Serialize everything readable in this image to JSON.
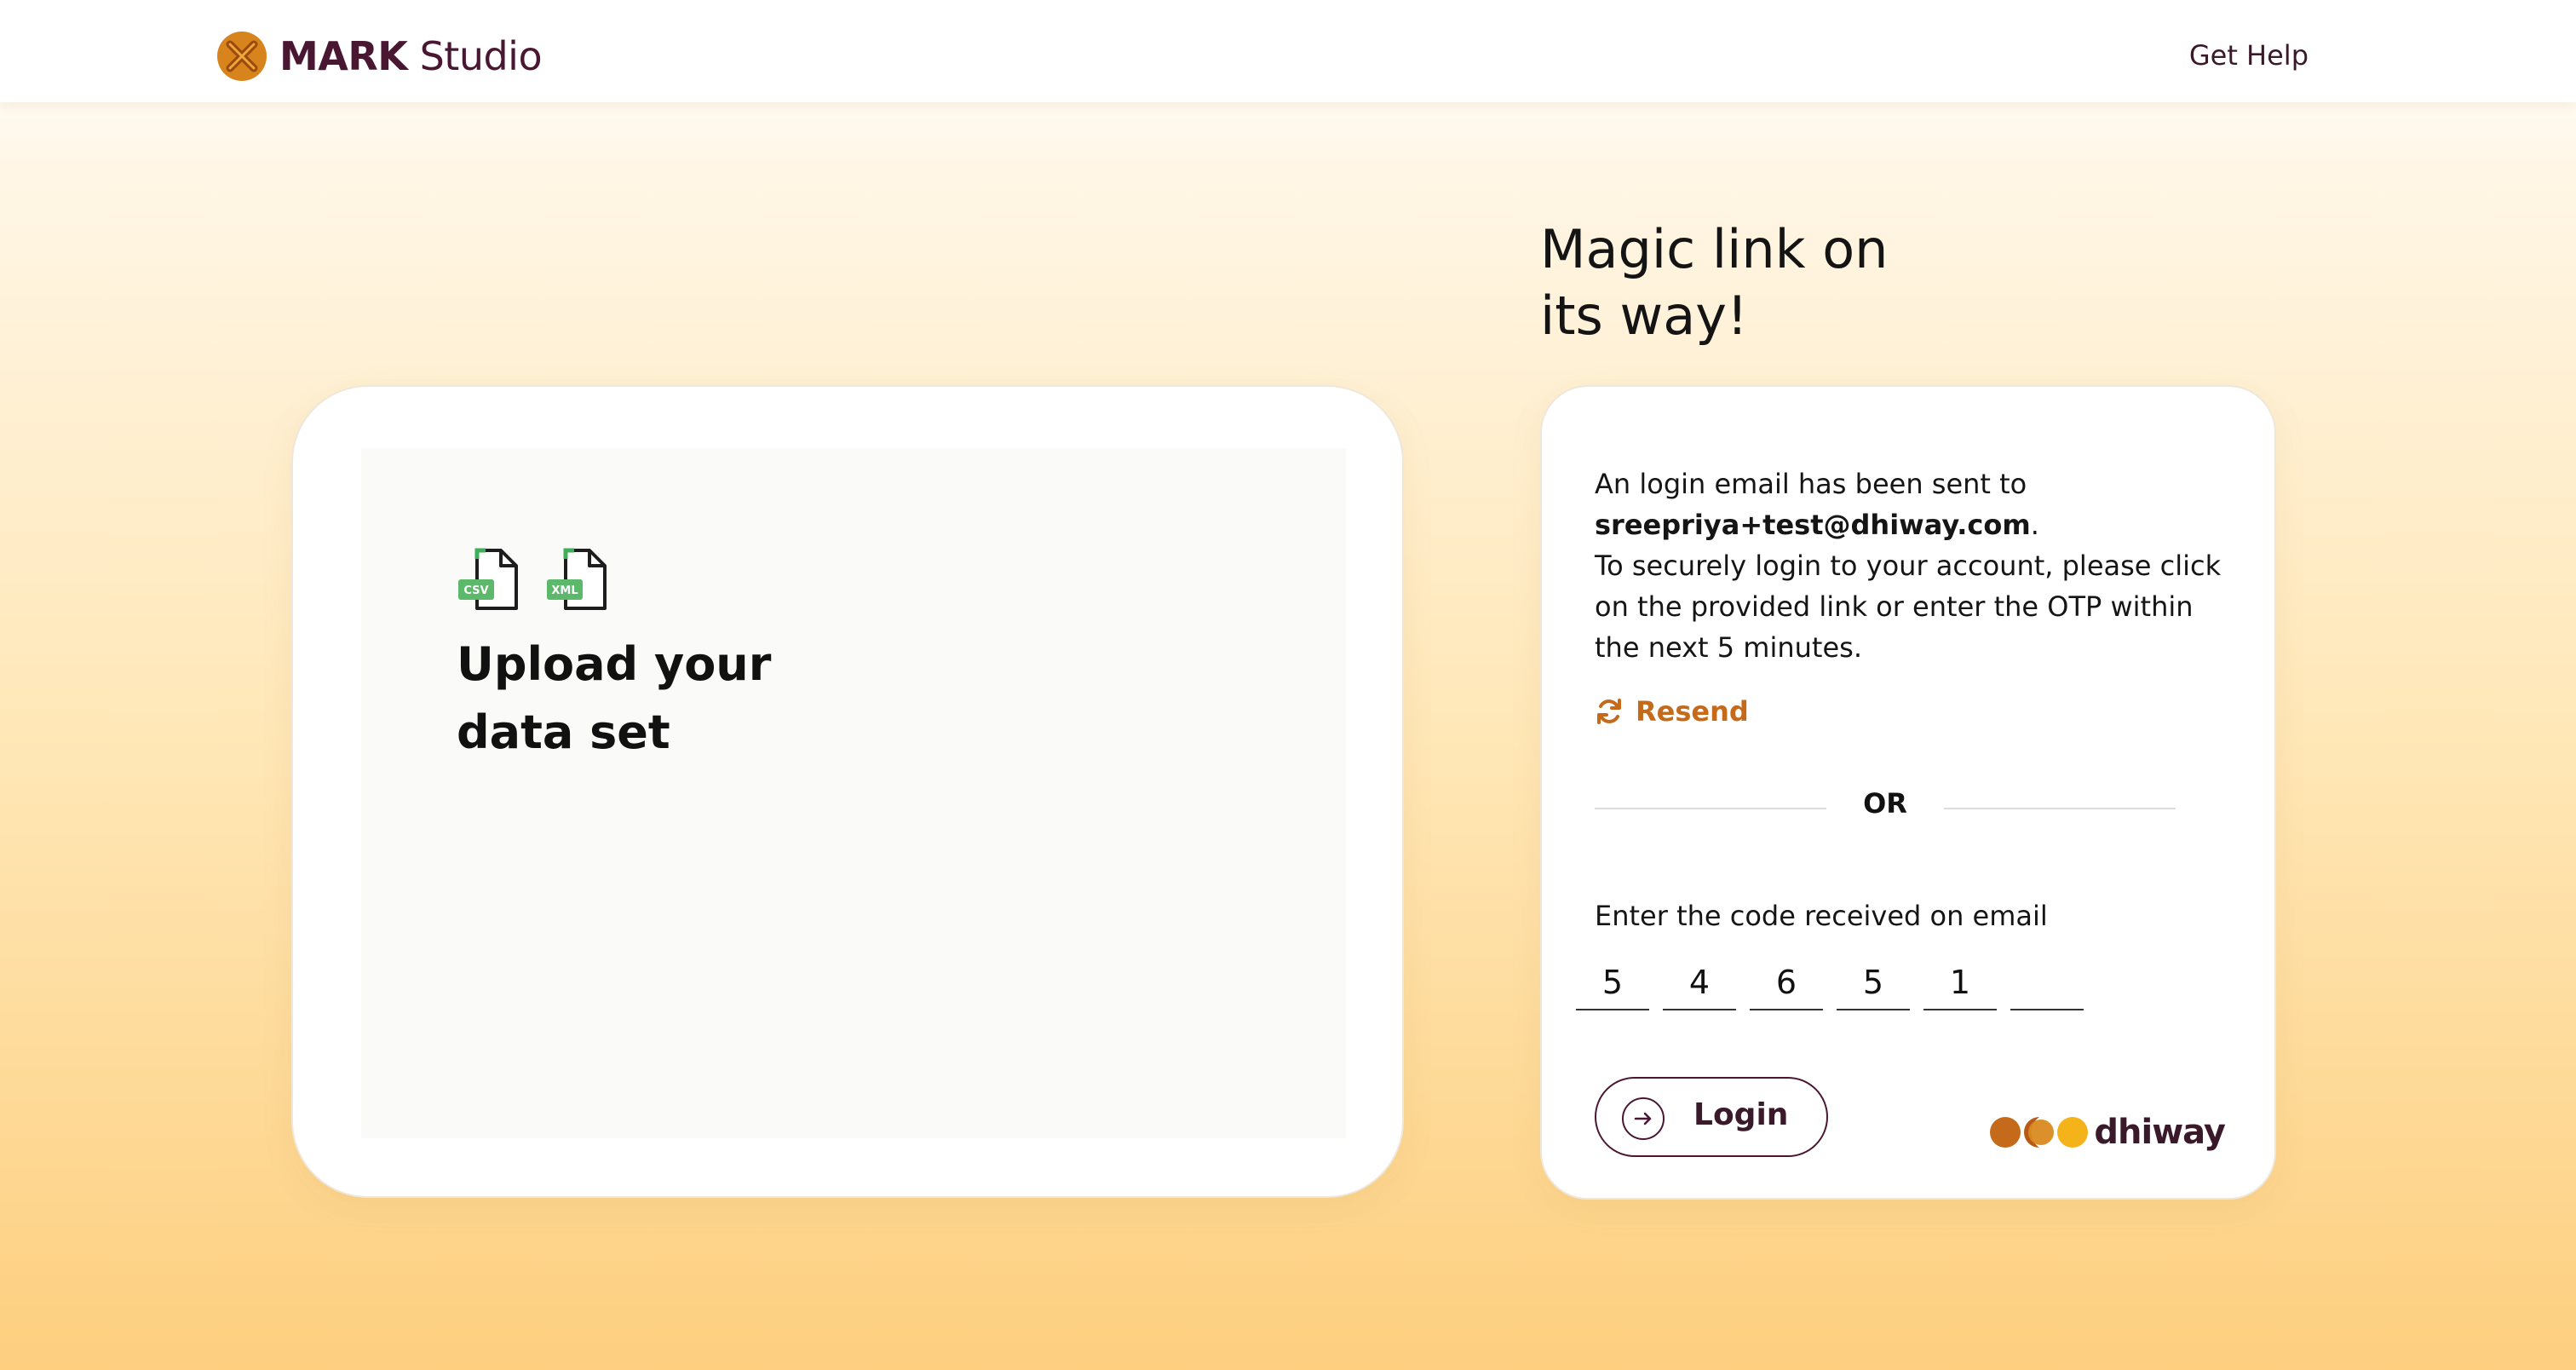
{
  "header": {
    "brand_bold": "MARK",
    "brand_light": "Studio",
    "help_label": "Get Help"
  },
  "left_card": {
    "file_icons": [
      {
        "name": "csv-file-icon",
        "tag": "CSV"
      },
      {
        "name": "xml-file-icon",
        "tag": "XML"
      }
    ],
    "title_line1": "Upload your",
    "title_line2": "data set"
  },
  "magic": {
    "title_line1": "Magic link on",
    "title_line2": "its way!"
  },
  "login_card": {
    "message_intro": "An login email has been sent to",
    "email": "sreepriya+test@dhiway.com",
    "email_suffix": ".",
    "message_body": "To securely login to your account, please click on the provided link or enter the OTP within the next 5 minutes.",
    "resend_label": "Resend",
    "or_label": "OR",
    "otp_label": "Enter the code received on email",
    "otp_digits": [
      "5",
      "4",
      "6",
      "5",
      "1",
      ""
    ],
    "login_label": "Login",
    "partner_name": "dhiway"
  },
  "colors": {
    "brand": "#4a1733",
    "accent": "#c46a1a",
    "gradient_bottom": "#fdcf7f",
    "dhiway_dot_1": "#c46a1a",
    "dhiway_dot_2": "#d98a20",
    "dhiway_dot_3": "#f5b31a"
  }
}
